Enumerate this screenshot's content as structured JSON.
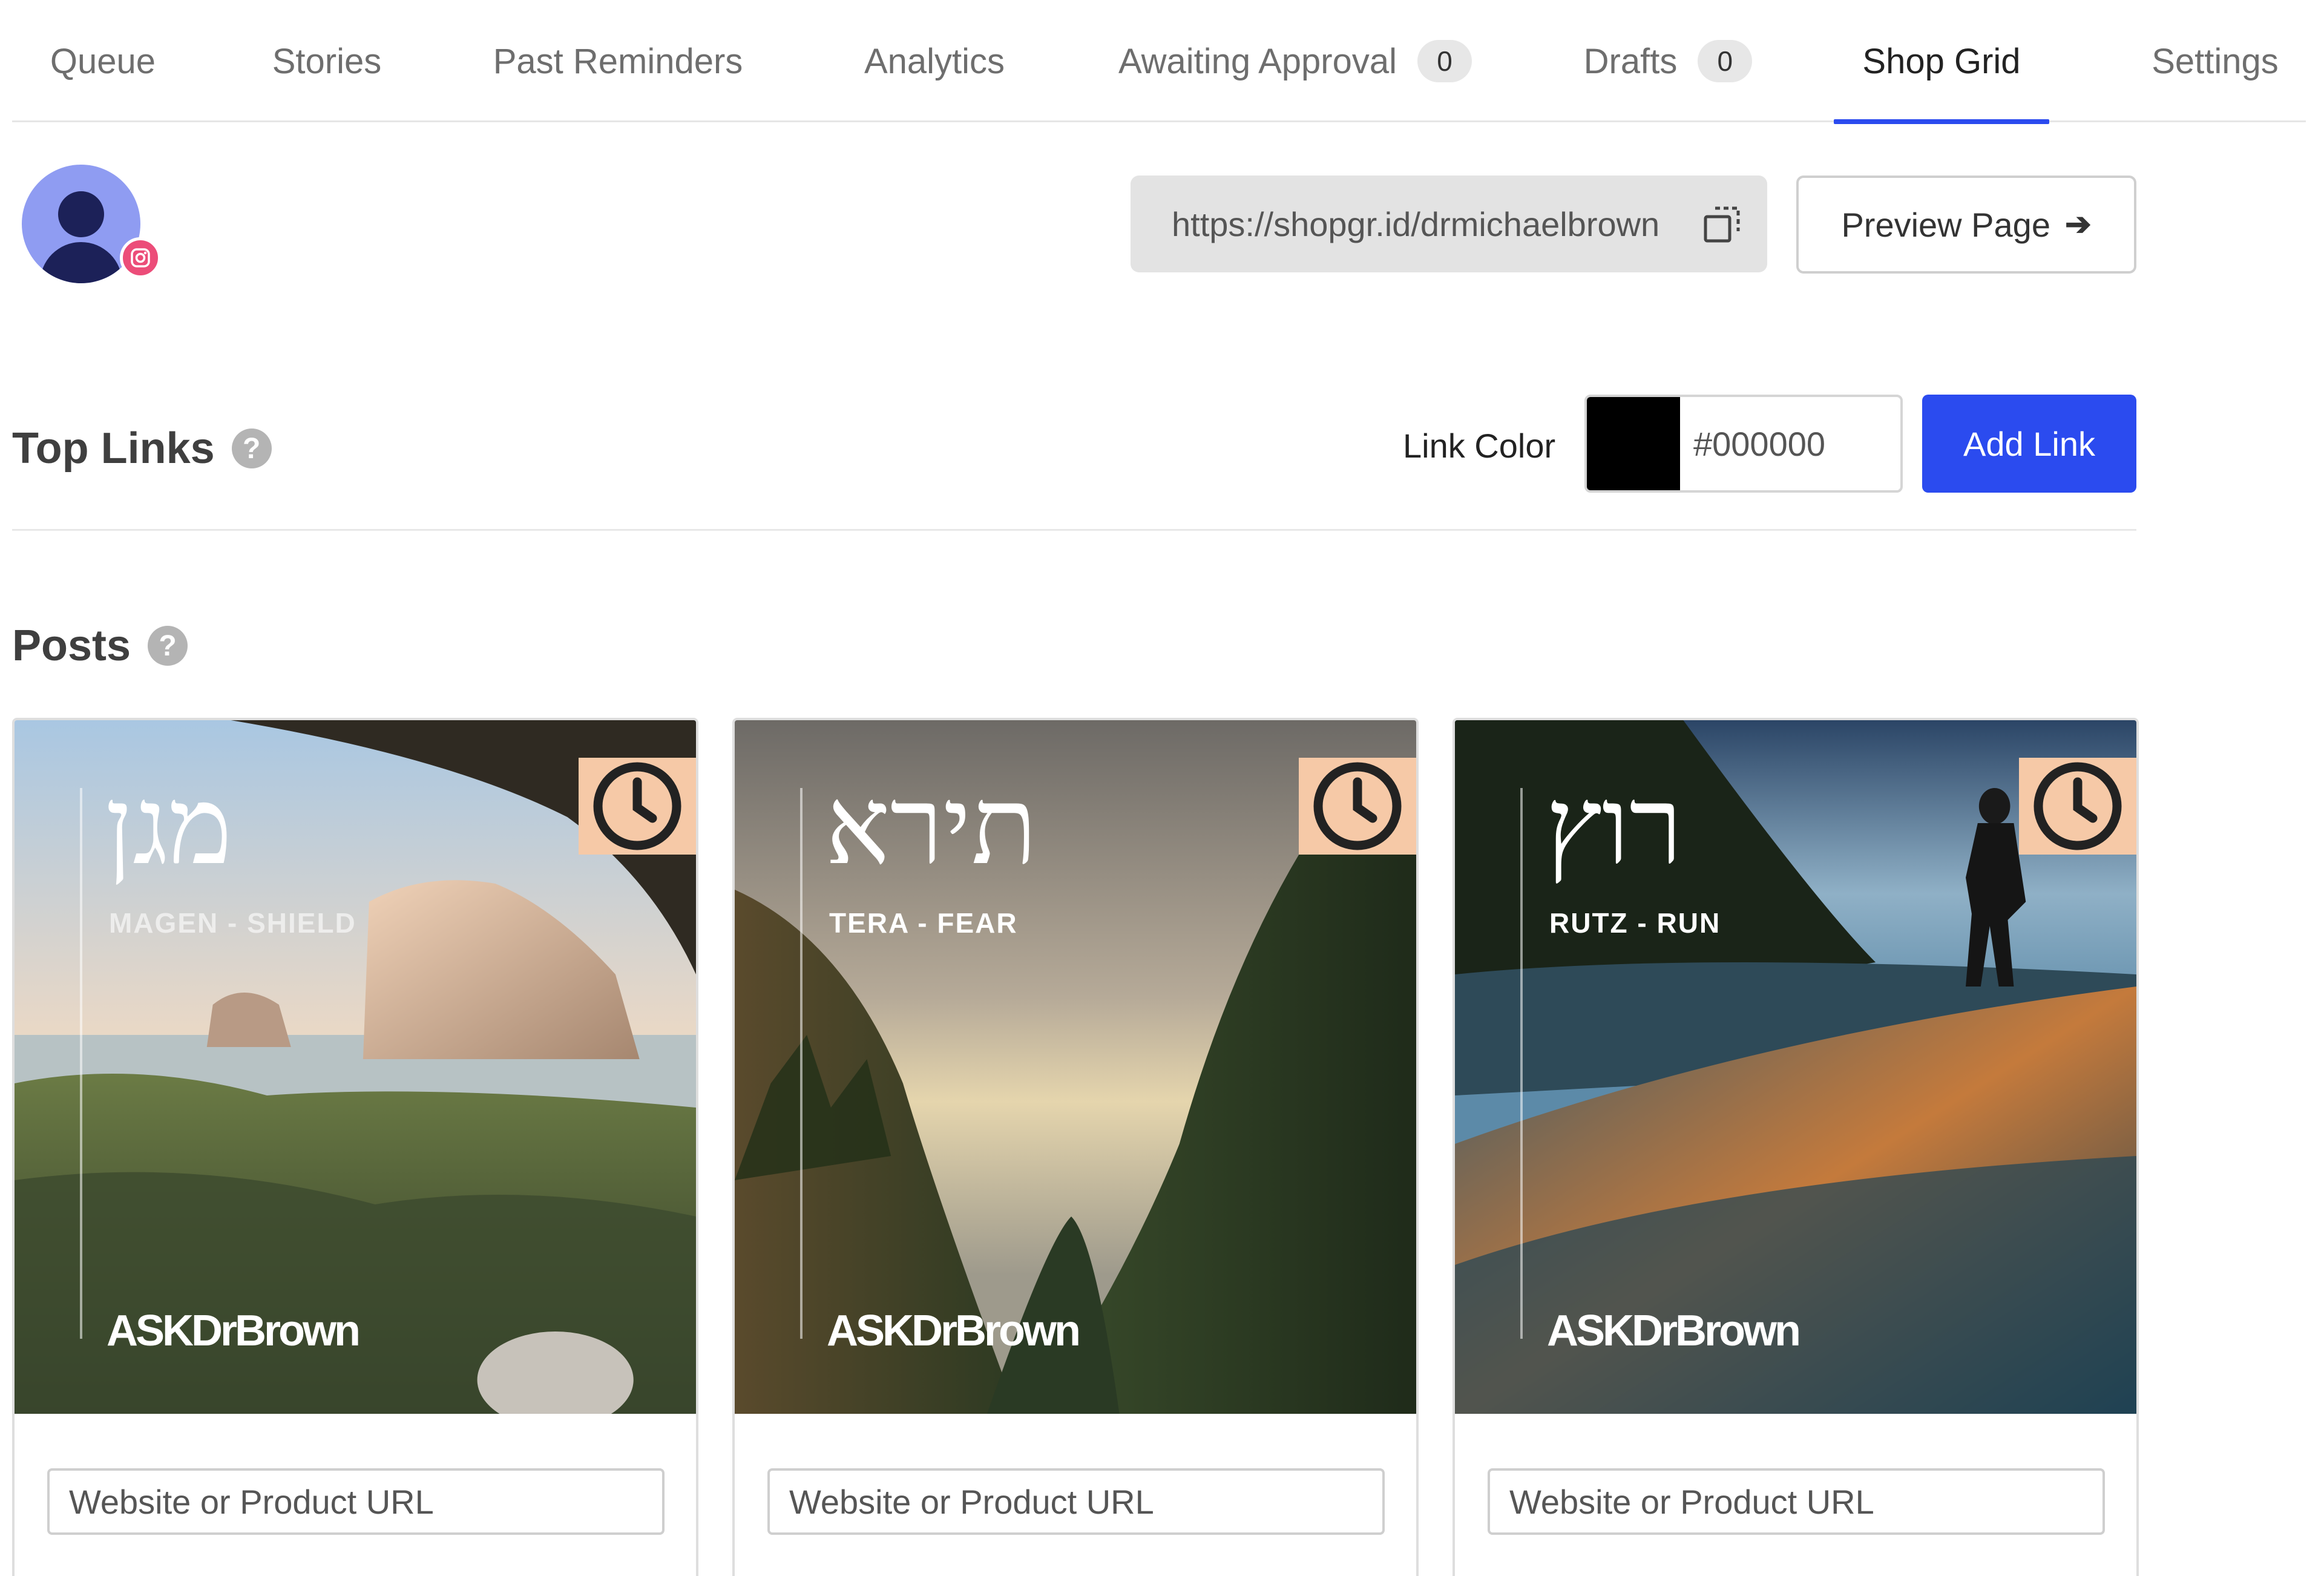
{
  "tabs": [
    {
      "label": "Queue"
    },
    {
      "label": "Stories"
    },
    {
      "label": "Past Reminders"
    },
    {
      "label": "Analytics"
    },
    {
      "label": "Awaiting Approval",
      "count": "0"
    },
    {
      "label": "Drafts",
      "count": "0"
    },
    {
      "label": "Shop Grid",
      "active": true
    },
    {
      "label": "Settings"
    }
  ],
  "profile": {
    "avatar_icon": "user-avatar-icon",
    "badge_icon": "instagram-icon",
    "shop_url": "https://shopgr.id/drmichaelbrown",
    "copy_icon": "copy-icon",
    "preview_label": "Preview Page",
    "preview_icon": "arrow-right-icon"
  },
  "top_links": {
    "title": "Top Links",
    "help_icon": "?",
    "link_color_label": "Link Color",
    "link_color_value": "#000000",
    "add_link_label": "Add Link"
  },
  "posts": {
    "title": "Posts",
    "help_icon": "?",
    "url_placeholder": "Website or Product URL",
    "items": [
      {
        "hebrew": "מגן",
        "subtitle": "MAGEN - SHIELD",
        "brand": "ASKDrBrown",
        "icon": "clock-icon"
      },
      {
        "hebrew": "תירא",
        "subtitle": "TERA - FEAR",
        "brand": "ASKDrBrown",
        "icon": "clock-icon"
      },
      {
        "hebrew": "רוץ",
        "subtitle": "RUTZ - RUN",
        "brand": "ASKDrBrown",
        "icon": "clock-icon"
      }
    ]
  },
  "colors": {
    "accent": "#2b4bef",
    "clock_badge": "#f6c9a7",
    "instagram_badge": "#ec4d79"
  }
}
